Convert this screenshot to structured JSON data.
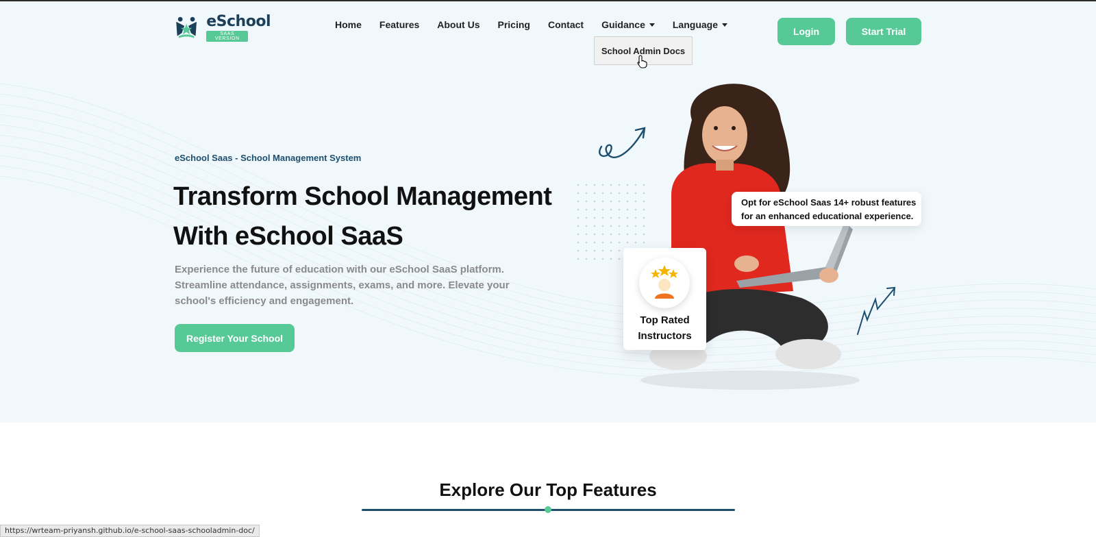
{
  "header": {
    "logo": {
      "name": "eSchool",
      "badge": "SAAS VERSION"
    },
    "nav": [
      {
        "label": "Home"
      },
      {
        "label": "Features"
      },
      {
        "label": "About Us"
      },
      {
        "label": "Pricing"
      },
      {
        "label": "Contact"
      },
      {
        "label": "Guidance",
        "dropdown": true
      },
      {
        "label": "Language",
        "dropdown": true
      }
    ],
    "guidance_dropdown": {
      "item": "School Admin Docs"
    },
    "login_label": "Login",
    "trial_label": "Start Trial"
  },
  "hero": {
    "eyebrow": "eSchool Saas - School Management System",
    "title_line1": "Transform School Management",
    "title_line2": "With eSchool SaaS",
    "description": "Experience the future of education with our eSchool SaaS platform. Streamline attendance, assignments, exams, and more. Elevate your school's efficiency and engagement.",
    "register_label": "Register Your School",
    "rated_card": {
      "line1": "Top Rated",
      "line2": "Instructors"
    },
    "feature_card": {
      "line1": "Opt for eSchool Saas 14+ robust features",
      "line2": "for an enhanced educational experience."
    }
  },
  "features": {
    "title": "Explore Our Top Features"
  },
  "status_url": "https://wrteam-priyansh.github.io/e-school-saas-schooladmin-doc/",
  "colors": {
    "accent_green": "#57c997",
    "navy": "#1c4e6e",
    "hero_bg": "#f1f8fc",
    "hoodie_red": "#e0281f"
  },
  "icons": [
    "logo-icon",
    "caret-down-icon",
    "star-award-icon",
    "swirl-arrow-icon",
    "zigzag-arrow-icon",
    "pointer-cursor-icon"
  ]
}
